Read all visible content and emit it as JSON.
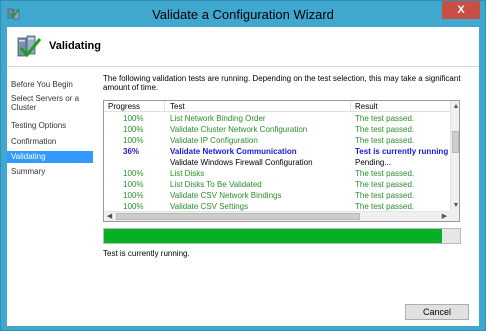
{
  "window": {
    "title": "Validate a Configuration Wizard",
    "close_label": "X",
    "accent": "#40a8cf"
  },
  "header": {
    "title": "Validating",
    "icon": "cluster-validate-icon"
  },
  "sidebar": {
    "items": [
      {
        "label": "Before You Begin"
      },
      {
        "label": "Select Servers or a Cluster"
      },
      {
        "label": "Testing Options"
      },
      {
        "label": "Confirmation"
      },
      {
        "label": "Validating",
        "active": true
      },
      {
        "label": "Summary"
      }
    ]
  },
  "main": {
    "intro": "The following validation tests are running. Depending on the test selection, this may take a significant amount of time.",
    "columns": [
      "Progress",
      "Test",
      "Result"
    ],
    "rows": [
      {
        "progress": "100%",
        "test": "List Network Binding Order",
        "result": "The test passed.",
        "state": "passed"
      },
      {
        "progress": "100%",
        "test": "Validate Cluster Network Configuration",
        "result": "The test passed.",
        "state": "passed"
      },
      {
        "progress": "100%",
        "test": "Validate IP Configuration",
        "result": "The test passed.",
        "state": "passed"
      },
      {
        "progress": "36%",
        "test": "Validate Network Communication",
        "result": "Test is currently running.",
        "state": "running"
      },
      {
        "progress": "",
        "test": "Validate Windows Firewall Configuration",
        "result": "Pending...",
        "state": "pending"
      },
      {
        "progress": "100%",
        "test": "List Disks",
        "result": "The test passed.",
        "state": "passed"
      },
      {
        "progress": "100%",
        "test": "List Disks To Be Validated",
        "result": "The test passed.",
        "state": "passed"
      },
      {
        "progress": "100%",
        "test": "Validate CSV Network Bindings",
        "result": "The test passed.",
        "state": "passed"
      },
      {
        "progress": "100%",
        "test": "Validate CSV Settings",
        "result": "The test passed.",
        "state": "passed"
      }
    ],
    "overall_progress": 0.95,
    "status": "Test is currently running.",
    "colors": {
      "passed": "#2a8f2a",
      "running": "#1a1ad6",
      "progress": "#06b025"
    }
  },
  "footer": {
    "cancel_label": "Cancel"
  }
}
